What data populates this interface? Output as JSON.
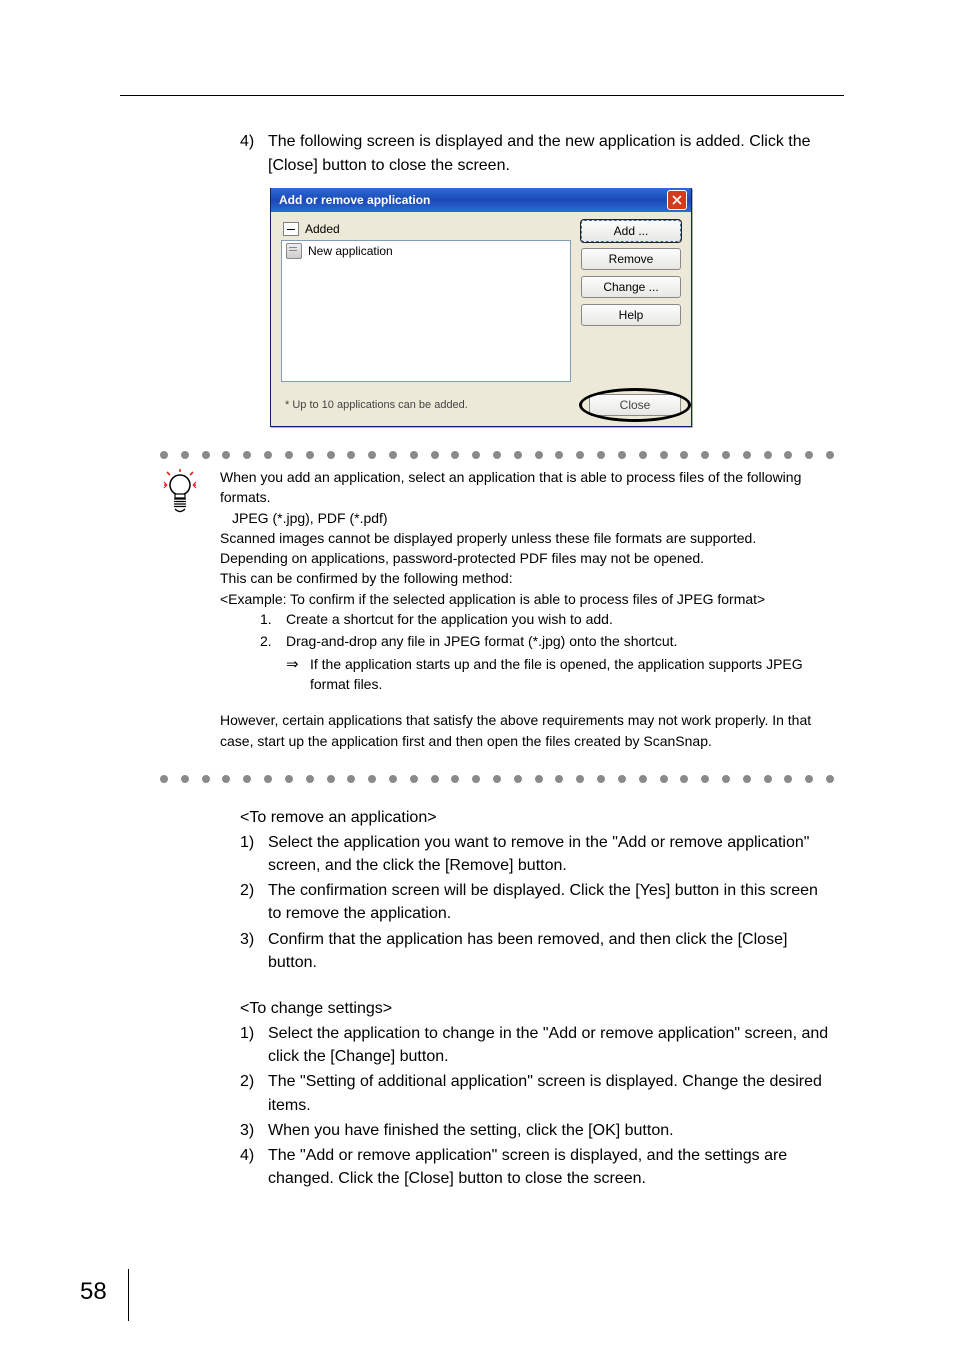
{
  "mainStep": {
    "num": "4)",
    "text": "The following screen is displayed and the new application is added. Click the [Close] button to close the screen."
  },
  "dialog": {
    "title": "Add or remove application",
    "listHeader": "Added",
    "item1": "New application",
    "footNote": "* Up to 10 applications can be added.",
    "buttons": {
      "add": "Add ...",
      "remove": "Remove",
      "change": "Change ...",
      "help": "Help",
      "close": "Close"
    }
  },
  "tip": {
    "p1": "When you add an application, select an application that is able to process files of the following formats.",
    "formats": "JPEG (*.jpg), PDF (*.pdf)",
    "p2": "Scanned images cannot be displayed properly unless these file formats are supported.",
    "p3a": "Depending on applications, password-protected PDF files may not be opened.",
    "p3b": "This can be confirmed by the following method:",
    "p4": "<Example: To confirm if the selected application is able to process files of JPEG format>",
    "s1num": "1.",
    "s1": "Create a shortcut for the application you wish to add.",
    "s2num": "2.",
    "s2": "Drag-and-drop any file in JPEG format (*.jpg) onto the shortcut.",
    "s2arrow": "⇒",
    "s2sub": "If the application starts up and the file is opened, the application supports JPEG format files.",
    "p5": "However, certain applications that satisfy the above requirements may not work properly. In that case, start up the application first and then open the files created by ScanSnap."
  },
  "remove": {
    "heading": "<To remove an application>",
    "s1n": "1)",
    "s1": "Select the application you want to remove in the \"Add or remove application\" screen, and the click the [Remove] button.",
    "s2n": "2)",
    "s2": "The confirmation screen will be displayed. Click the [Yes] button in this screen to remove the application.",
    "s3n": "3)",
    "s3": "Confirm that the application has been removed, and then click the [Close] button."
  },
  "change": {
    "heading": "<To change settings>",
    "s1n": "1)",
    "s1": "Select the application to change in the \"Add or remove application\" screen, and click the [Change] button.",
    "s2n": "2)",
    "s2": "The \"Setting of additional application\" screen is displayed. Change the desired items.",
    "s3n": "3)",
    "s3": "When you have finished the setting, click the [OK] button.",
    "s4n": "4)",
    "s4": "The \"Add or remove application\" screen is displayed, and the settings are changed. Click the [Close] button to close the screen."
  },
  "pageNumber": "58"
}
